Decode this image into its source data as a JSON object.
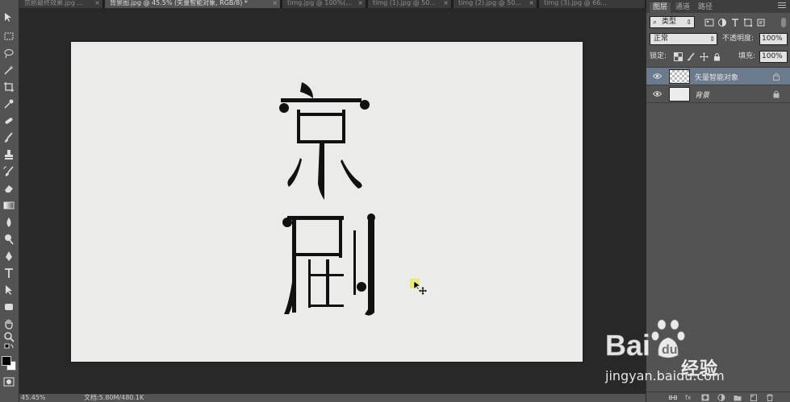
{
  "document_tabs": [
    {
      "label": "京剧最终效果.jpg ...",
      "active": false
    },
    {
      "label": "背景图.jpg @ 45.5% (矢量智能对象, RGB/8) *",
      "active": true
    },
    {
      "label": "timg.jpg @ 100%(...",
      "active": false
    },
    {
      "label": "timg (1).jpg @ 50...",
      "active": false
    },
    {
      "label": "timg (2).jpg @ 50...",
      "active": false
    },
    {
      "label": "timg (3).jpg @ 66...",
      "active": false
    }
  ],
  "tab_close_glyph": "×",
  "canvas": {
    "background": "#ebecea"
  },
  "statusbar": {
    "zoom": "45.45%",
    "doc_info": "文档:5.80M/480.1K"
  },
  "panel": {
    "tabs": [
      "图层",
      "通道",
      "路径"
    ],
    "kind_filter": "类型",
    "blend_mode": "正常",
    "opacity_label": "不透明度:",
    "opacity_value": "100%",
    "lock_label": "锁定:",
    "fill_label": "填充:",
    "fill_value": "100%"
  },
  "layers": [
    {
      "name": "矢量智能对象",
      "selected": true,
      "thumbnail": "checker"
    },
    {
      "name": "背景",
      "selected": false,
      "thumbnail": "light"
    }
  ],
  "watermark": {
    "brand": "Bai",
    "logo_tail": "经验",
    "url": "jingyan.baidu.com"
  },
  "colors": {
    "accent_selected_layer": "#6b7b8d",
    "ui_panel": "#535353",
    "workspace": "#282828"
  }
}
